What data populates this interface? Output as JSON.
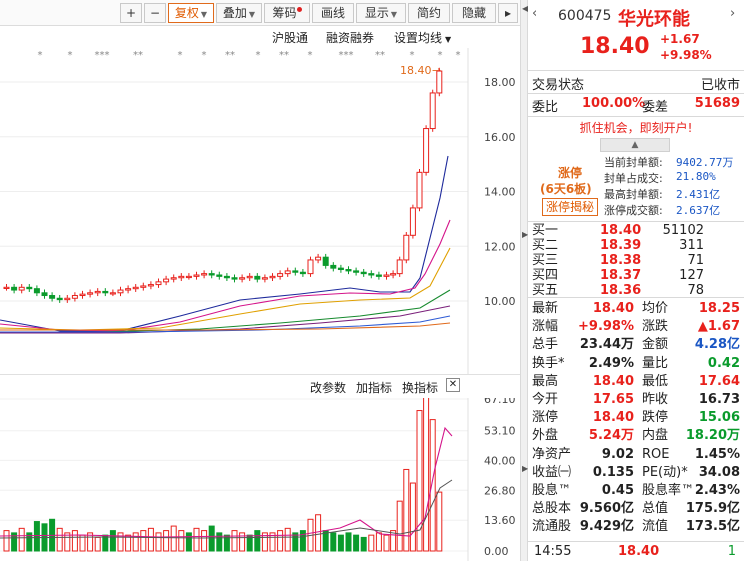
{
  "toolbar": {
    "zoom_in": "+",
    "zoom_out": "−",
    "fuquan": "复权",
    "diejia": "叠加",
    "chouma": "筹码",
    "huaxian": "画线",
    "xianshi": "显示",
    "jianyue": "简约",
    "yincang": "隐藏"
  },
  "subbar": {
    "hugutong": "沪股通",
    "rongzi": "融资融券",
    "shezhi": "设置均线"
  },
  "kline": {
    "price_tag": "18.40",
    "price_tag_arrow": "→",
    "y_ticks": [
      "18.00",
      "16.00",
      "14.00",
      "12.00",
      "10.00"
    ],
    "y_values": [
      18,
      16,
      14,
      12,
      10
    ],
    "star_groups": [
      "*",
      "*",
      "***",
      "**",
      "*",
      "*",
      "**",
      "*",
      "**",
      "*",
      "***",
      "**",
      "*",
      "*",
      "*"
    ]
  },
  "volume": {
    "gai_canshu": "改参数",
    "jia_zhibiao": "加指标",
    "huan_zhibiao": "换指标",
    "close_x": "✕",
    "y_ticks": [
      "67.10",
      "53.10",
      "40.00",
      "26.80",
      "13.60",
      "0.00"
    ]
  },
  "quote": {
    "code": "600475",
    "name": "华光环能",
    "price": "18.40",
    "change": "+1.67",
    "change_pct": "+9.98%",
    "status_label": "交易状态",
    "status_value": "已收市",
    "weibi_label": "委比",
    "weibi_value": "100.00%",
    "weicha_label": "委差",
    "weicha_value": "51689",
    "promo": "抓住机会，即刻开户!",
    "zhangting": "涨停",
    "zhangting_days": "(6天6板)",
    "zhangting_btn": "涨停揭秘",
    "fengdan": [
      {
        "label": "当前封单额:",
        "value": "9402.77万"
      },
      {
        "label": "封单占成交:",
        "value": "21.80%"
      },
      {
        "label": "最高封单额:",
        "value": "2.431亿"
      },
      {
        "label": "涨停成交额:",
        "value": "2.637亿"
      }
    ],
    "bids": [
      {
        "label": "买一",
        "price": "18.40",
        "vol": "51102"
      },
      {
        "label": "买二",
        "price": "18.39",
        "vol": "311"
      },
      {
        "label": "买三",
        "price": "18.38",
        "vol": "71"
      },
      {
        "label": "买四",
        "price": "18.37",
        "vol": "127"
      },
      {
        "label": "买五",
        "price": "18.36",
        "vol": "78"
      }
    ],
    "stats": [
      {
        "l1": "最新",
        "v1": "18.40",
        "c1": "red",
        "l2": "均价",
        "v2": "18.25",
        "c2": "red"
      },
      {
        "l1": "涨幅",
        "v1": "+9.98%",
        "c1": "red",
        "l2": "涨跌",
        "v2": "▲1.67",
        "c2": "red"
      },
      {
        "l1": "总手",
        "v1": "23.44万",
        "c1": "black",
        "l2": "金额",
        "v2": "4.28亿",
        "c2": "blue"
      },
      {
        "l1": "换手*",
        "v1": "2.49%",
        "c1": "black",
        "l2": "量比",
        "v2": "0.42",
        "c2": "green"
      },
      {
        "l1": "最高",
        "v1": "18.40",
        "c1": "red",
        "l2": "最低",
        "v2": "17.64",
        "c2": "red"
      },
      {
        "l1": "今开",
        "v1": "17.65",
        "c1": "red",
        "l2": "昨收",
        "v2": "16.73",
        "c2": "black"
      },
      {
        "l1": "涨停",
        "v1": "18.40",
        "c1": "red",
        "l2": "跌停",
        "v2": "15.06",
        "c2": "green"
      },
      {
        "l1": "外盘",
        "v1": "5.24万",
        "c1": "red",
        "l2": "内盘",
        "v2": "18.20万",
        "c2": "green"
      },
      {
        "l1": "净资产",
        "v1": "9.02",
        "c1": "black",
        "l2": "ROE",
        "v2": "1.45%",
        "c2": "black"
      },
      {
        "l1": "收益㈠",
        "v1": "0.135",
        "c1": "black",
        "l2": "PE(动)*",
        "v2": "34.08",
        "c2": "black"
      },
      {
        "l1": "股息™",
        "v1": "0.45",
        "c1": "black",
        "l2": "股息率™",
        "v2": "2.43%",
        "c2": "black"
      },
      {
        "l1": "总股本",
        "v1": "9.560亿",
        "c1": "black",
        "l2": "总值",
        "v2": "175.9亿",
        "c2": "black"
      },
      {
        "l1": "流通股",
        "v1": "9.429亿",
        "c1": "black",
        "l2": "流值",
        "v2": "173.5亿",
        "c2": "black"
      }
    ],
    "tick": {
      "time": "14:55",
      "price": "18.40",
      "vol": "1"
    }
  },
  "colors": {
    "up": "#e8211c",
    "down": "#0a9b2c",
    "blue": "#1a56c4",
    "orange": "#e06a1b"
  }
}
